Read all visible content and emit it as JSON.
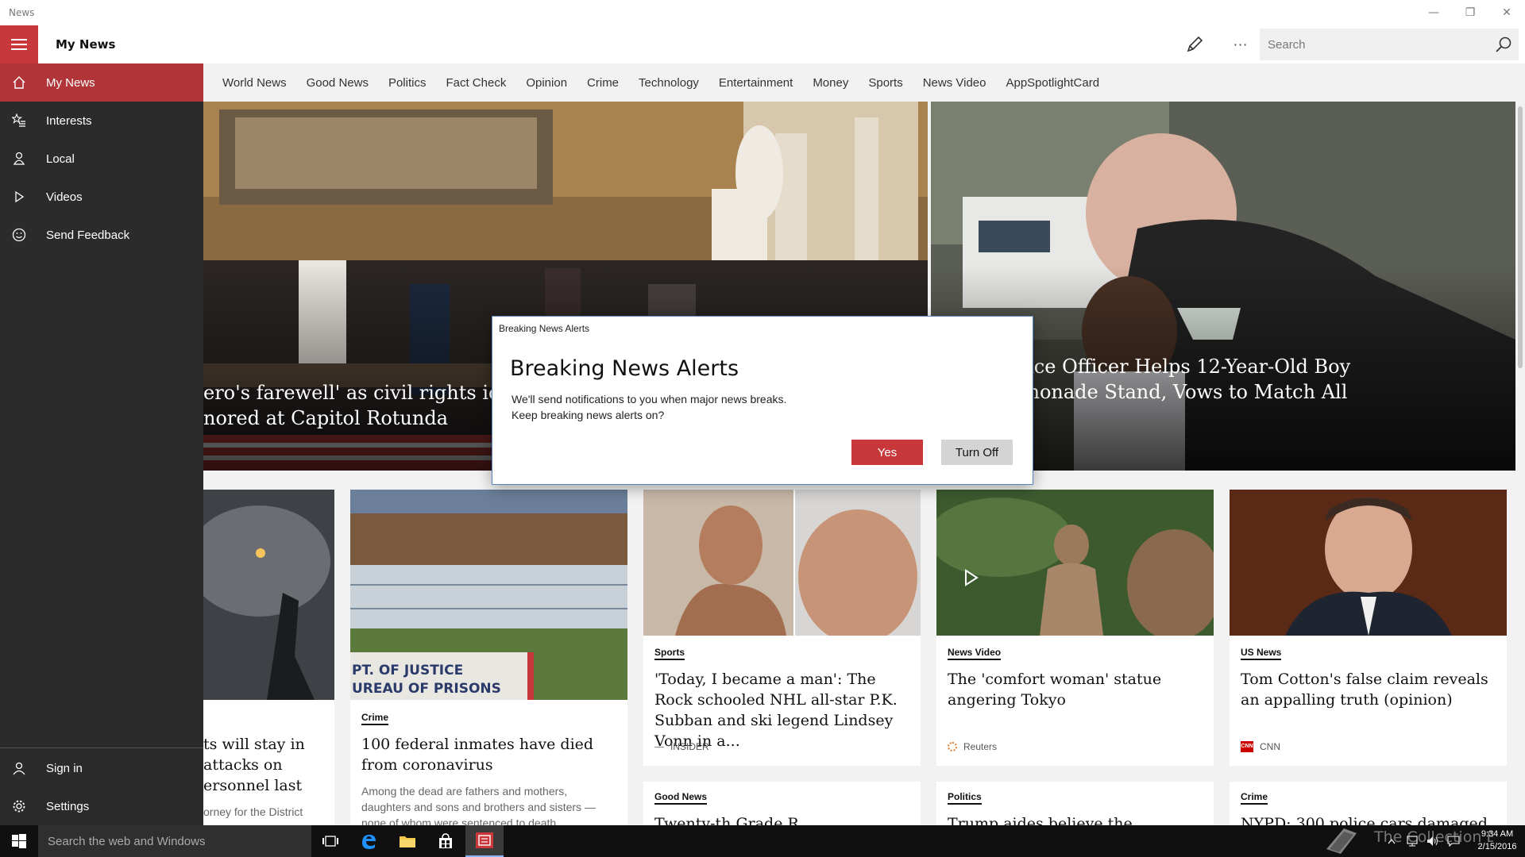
{
  "window": {
    "app_title": "News",
    "minimize_glyph": "—",
    "restore_glyph": "❐",
    "close_glyph": "✕"
  },
  "header": {
    "page_title": "My News",
    "more_label": "···",
    "search_placeholder": "Search"
  },
  "sidebar": {
    "items": [
      {
        "label": "My News",
        "icon": "home-icon",
        "active": true
      },
      {
        "label": "Interests",
        "icon": "star-list-icon"
      },
      {
        "label": "Local",
        "icon": "person-pin-icon"
      },
      {
        "label": "Videos",
        "icon": "play-icon"
      },
      {
        "label": "Send Feedback",
        "icon": "smiley-icon"
      }
    ],
    "bottom": [
      {
        "label": "Sign in",
        "icon": "person-icon"
      },
      {
        "label": "Settings",
        "icon": "gear-icon"
      }
    ]
  },
  "tabs": [
    "World News",
    "Good News",
    "Politics",
    "Fact Check",
    "Opinion",
    "Crime",
    "Technology",
    "Entertainment",
    "Money",
    "Sports",
    "News Video",
    "AppSpotlightCard"
  ],
  "hero": {
    "left": {
      "headline_line1": "ero's farewell' as civil rights icon",
      "headline_line2": "nored at Capitol Rotunda"
    },
    "right": {
      "headline_line1": "olice Officer Helps 12-Year-Old Boy",
      "headline_line2": "emonade Stand, Vows to Match All"
    }
  },
  "cards": {
    "c1": {
      "title": "ts will stay in attacks on ersonnel last",
      "desc": "orney for the District"
    },
    "c2": {
      "category": "Crime",
      "title": "100 federal inmates have died from coronavirus",
      "desc": "Among the dead are fathers and mothers, daughters and sons and brothers and sisters — none of whom were sentenced to death.",
      "sign_line1": "PT. OF JUSTICE",
      "sign_line2": "UREAU OF PRISONS"
    },
    "c3": {
      "category": "Sports",
      "title": "'Today, I became a man': The Rock schooled NHL all-star P.K. Subban and ski legend Lindsey Vonn in a...",
      "source": "INSIDER"
    },
    "c4": {
      "category": "News Video",
      "title": "The 'comfort woman' statue angering Tokyo",
      "source": "Reuters"
    },
    "c5": {
      "category": "US News",
      "title": "Tom Cotton's false claim reveals an appalling truth (opinion)",
      "source": "CNN",
      "source_logo": "CNN"
    },
    "c6": {
      "category": "Good News",
      "title": "Twenty-th Grade R"
    },
    "c7": {
      "category": "Politics",
      "title": "Trump aides believe the president"
    },
    "c8": {
      "category": "Crime",
      "title": "NYPD: 300 police cars damaged"
    }
  },
  "dialog": {
    "caption": "Breaking News Alerts",
    "heading": "Breaking News Alerts",
    "body_line1": "We'll send notifications to you when major news breaks.",
    "body_line2": "Keep breaking news alerts on?",
    "yes_label": "Yes",
    "turnoff_label": "Turn Off"
  },
  "taskbar": {
    "search_placeholder": "Search the web and Windows",
    "clock_time": "9:34 AM",
    "clock_date": "2/15/2016",
    "watermark_text": "The Collection Book"
  },
  "colors": {
    "accent": "#c8383b",
    "sidebar_bg": "#2b2b2b",
    "active_item": "#b13538"
  }
}
